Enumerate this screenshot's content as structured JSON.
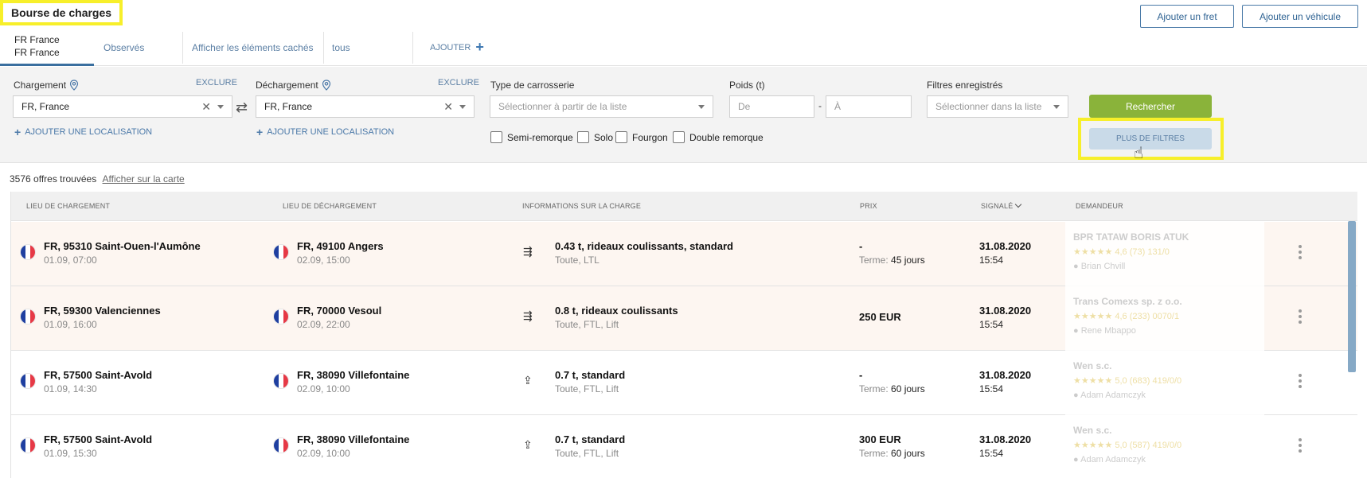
{
  "header": {
    "title": "Bourse de charges",
    "add_freight": "Ajouter un fret",
    "add_vehicle": "Ajouter un véhicule"
  },
  "tabs": {
    "active_line1": "FR France",
    "active_line2": "FR France",
    "observed": "Observés",
    "hidden": "Afficher les éléments cachés",
    "all": "tous",
    "add": "AJOUTER"
  },
  "filters": {
    "loading_label": "Chargement",
    "unloading_label": "Déchargement",
    "exclude": "EXCLURE",
    "loading_value": "FR,  France",
    "unloading_value": "FR,  France",
    "add_location": "AJOUTER UNE LOCALISATION",
    "body_type_label": "Type de carrosserie",
    "body_type_placeholder": "Sélectionner à partir de la liste",
    "weight_label": "Poids (t)",
    "weight_from": "De",
    "weight_to": "À",
    "weight_dash": "-",
    "saved_label": "Filtres enregistrés",
    "saved_placeholder": "Sélectionner dans la liste",
    "checkboxes": [
      "Semi-remorque",
      "Solo",
      "Fourgon",
      "Double remorque"
    ],
    "search": "Rechercher",
    "more": "PLUS DE FILTRES"
  },
  "results": {
    "count": "3576",
    "found_text": "offres trouvées",
    "map_link": "Afficher sur la carte"
  },
  "table": {
    "headers": {
      "loading": "LIEU DE CHARGEMENT",
      "unloading": "LIEU DE DÉCHARGEMENT",
      "info": "INFORMATIONS SUR LA CHARGE",
      "price": "PRIX",
      "reported": "SIGNALÉ",
      "requester": "DEMANDEUR"
    },
    "term_label": "Terme:",
    "rows": [
      {
        "from": "FR, 95310 Saint-Ouen-l'Aumône",
        "from_date": "01.09, 07:00",
        "to": "FR, 49100 Angers",
        "to_date": "02.09, 15:00",
        "cargo": "0.43 t, rideaux coulissants, standard",
        "cargo_sub": "Toute, LTL",
        "price": "-",
        "term": "45 jours",
        "date": "31.08.2020",
        "time": "15:54",
        "req_name": "BPR TATAW BORIS ATUK",
        "req_rating": "4,6 (73) 131/0",
        "req_contact": "Brian Chvill"
      },
      {
        "from": "FR, 59300 Valenciennes",
        "from_date": "01.09, 16:00",
        "to": "FR, 70000 Vesoul",
        "to_date": "02.09, 22:00",
        "cargo": "0.8 t, rideaux coulissants",
        "cargo_sub": "Toute, FTL, Lift",
        "price": "250 EUR",
        "term": "",
        "date": "31.08.2020",
        "time": "15:54",
        "req_name": "Trans Comexs sp. z o.o.",
        "req_rating": "4,6 (233) 0070/1",
        "req_contact": "Rene Mbappo"
      },
      {
        "from": "FR, 57500 Saint-Avold",
        "from_date": "01.09, 14:30",
        "to": "FR, 38090 Villefontaine",
        "to_date": "02.09, 10:00",
        "cargo": "0.7 t, standard",
        "cargo_sub": "Toute, FTL, Lift",
        "price": "-",
        "term": "60 jours",
        "date": "31.08.2020",
        "time": "15:54",
        "req_name": "Wen s.c.",
        "req_rating": "5,0 (683) 419/0/0",
        "req_contact": "Adam Adamczyk"
      },
      {
        "from": "FR, 57500 Saint-Avold",
        "from_date": "01.09, 15:30",
        "to": "FR, 38090 Villefontaine",
        "to_date": "02.09, 10:00",
        "cargo": "0.7 t, standard",
        "cargo_sub": "Toute, FTL, Lift",
        "price": "300 EUR",
        "term": "60 jours",
        "date": "31.08.2020",
        "time": "15:54",
        "req_name": "Wen s.c.",
        "req_rating": "5,0 (587) 419/0/0",
        "req_contact": "Adam Adamczyk"
      }
    ]
  },
  "colors": {
    "highlight": "#f7ef2a",
    "search_button": "#8ab33a",
    "more_button": "#c9dae8",
    "link": "#5b7fa4",
    "row_tint": "#fdf6f1"
  }
}
